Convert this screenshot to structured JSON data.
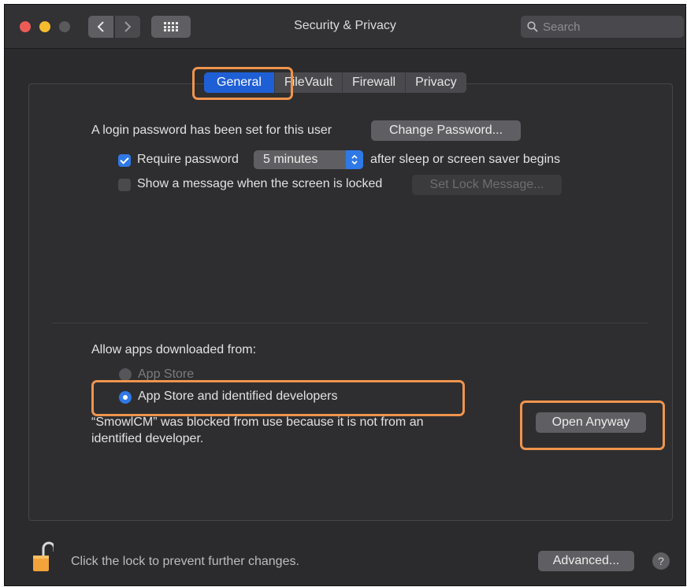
{
  "window": {
    "title": "Security & Privacy",
    "search_placeholder": "Search"
  },
  "tabs": [
    {
      "label": "General"
    },
    {
      "label": "FileVault"
    },
    {
      "label": "Firewall"
    },
    {
      "label": "Privacy"
    }
  ],
  "general": {
    "login_password_text": "A login password has been set for this user",
    "change_password_label": "Change Password...",
    "require_password_label": "Require password",
    "require_password_value": "5 minutes",
    "after_sleep_text": "after sleep or screen saver begins",
    "show_message_label": "Show a message when the screen is locked",
    "set_lock_message_label": "Set Lock Message..."
  },
  "downloads": {
    "heading": "Allow apps downloaded from:",
    "options": [
      {
        "label": "App Store"
      },
      {
        "label": "App Store and identified developers"
      }
    ],
    "blocked_line1": "“SmowlCM” was blocked from use because it is not from an",
    "blocked_line2": "identified developer.",
    "open_anyway_label": "Open Anyway"
  },
  "footer": {
    "lock_text": "Click the lock to prevent further changes.",
    "advanced_label": "Advanced...",
    "help_label": "?"
  },
  "colors": {
    "accent": "#2f79e7",
    "callout": "#f0944d"
  }
}
